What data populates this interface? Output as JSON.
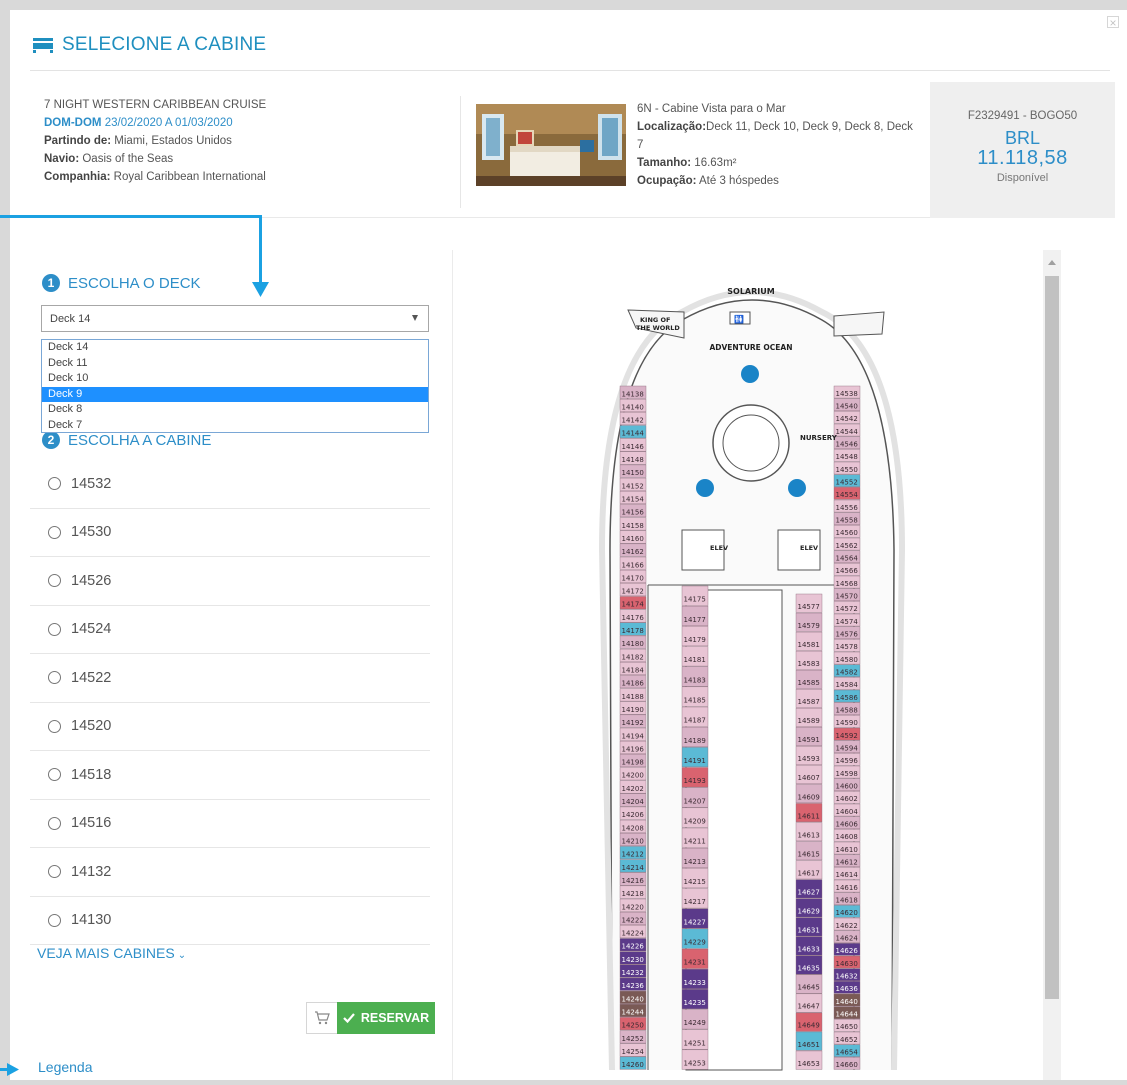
{
  "modal": {
    "title": "SELECIONE A CABINE",
    "close": "×"
  },
  "cruise": {
    "name": "7 NIGHT WESTERN CARIBBEAN CRUISE",
    "period_label": "DOM-DOM",
    "dates": "23/02/2020 A 01/03/2020",
    "departure_label": "Partindo de:",
    "departure": "Miami, Estados Unidos",
    "ship_label": "Navio:",
    "ship": "Oasis of the Seas",
    "company_label": "Companhia:",
    "company": "Royal Caribbean International"
  },
  "cabin_info": {
    "category": "6N - Cabine Vista para o Mar",
    "location_label": "Localização:",
    "location": "Deck 11, Deck 10, Deck 9, Deck 8, Deck 7",
    "size_label": "Tamanho:",
    "size": "16.63m²",
    "occupancy_label": "Ocupação:",
    "occupancy": "Até 3 hóspedes"
  },
  "price": {
    "code": "F2329491 - BOGO50",
    "currency": "BRL",
    "amount": "11.118,58",
    "status": "Disponível"
  },
  "step1": {
    "number": "1",
    "label": "ESCOLHA O DECK"
  },
  "step2": {
    "number": "2",
    "label": "ESCOLHA A CABINE"
  },
  "deck_select": {
    "value": "Deck 14",
    "options": [
      "Deck 14",
      "Deck 11",
      "Deck 10",
      "Deck 9",
      "Deck 8",
      "Deck 7"
    ],
    "highlighted": "Deck 9"
  },
  "cabins": [
    "14532",
    "14530",
    "14526",
    "14524",
    "14522",
    "14520",
    "14518",
    "14516",
    "14132",
    "14130"
  ],
  "more_cabins": "VEJA MAIS CABINES",
  "reserve_button": "RESERVAR",
  "legend_link": "Legenda",
  "deck_plan": {
    "labels": {
      "solarium": "SOLARIUM",
      "king1": "KING OF",
      "king2": "THE WORLD",
      "adventure": "ADVENTURE OCEAN",
      "nursery": "NURSERY",
      "elev": "ELEV"
    },
    "left_outer": [
      "14138",
      "14140",
      "14142",
      "14144",
      "14146",
      "14148",
      "14150",
      "14152",
      "14154",
      "14156",
      "14158",
      "14160",
      "14162",
      "14166",
      "14170",
      "14172",
      "14174",
      "14176",
      "14178",
      "14180",
      "14182",
      "14184",
      "14186",
      "14188",
      "14190",
      "14192",
      "14194",
      "14196",
      "14198",
      "14200",
      "14202",
      "14204",
      "14206",
      "14208",
      "14210",
      "14212",
      "14214",
      "14216",
      "14218",
      "14220",
      "14222",
      "14224",
      "14226",
      "14230",
      "14232",
      "14236",
      "14240",
      "14244",
      "14250",
      "14252",
      "14254",
      "14260"
    ],
    "left_inner": [
      "14175",
      "14177",
      "14179",
      "14181",
      "14183",
      "14185",
      "14187",
      "14189",
      "14191",
      "14193",
      "14207",
      "14209",
      "14211",
      "14213",
      "14215",
      "14217",
      "14227",
      "14229",
      "14231",
      "14233",
      "14235",
      "14249",
      "14251",
      "14253"
    ],
    "right_inner": [
      "14577",
      "14579",
      "14581",
      "14583",
      "14585",
      "14587",
      "14589",
      "14591",
      "14593",
      "14607",
      "14609",
      "14611",
      "14613",
      "14615",
      "14617",
      "14627",
      "14629",
      "14631",
      "14633",
      "14635",
      "14645",
      "14647",
      "14649",
      "14651",
      "14653"
    ],
    "right_outer": [
      "14538",
      "14540",
      "14542",
      "14544",
      "14546",
      "14548",
      "14550",
      "14552",
      "14554",
      "14556",
      "14558",
      "14560",
      "14562",
      "14564",
      "14566",
      "14568",
      "14570",
      "14572",
      "14574",
      "14576",
      "14578",
      "14580",
      "14582",
      "14584",
      "14586",
      "14588",
      "14590",
      "14592",
      "14594",
      "14596",
      "14598",
      "14600",
      "14602",
      "14604",
      "14606",
      "14608",
      "14610",
      "14612",
      "14614",
      "14616",
      "14618",
      "14620",
      "14622",
      "14624",
      "14626",
      "14630",
      "14632",
      "14636",
      "14640",
      "14644",
      "14650",
      "14652",
      "14654",
      "14660"
    ]
  },
  "colors": {
    "accent": "#2d8ec8",
    "selected_option": "#1e90ff",
    "reserve_green": "#4caf50",
    "annotation_arrow": "#1ba1e2"
  }
}
